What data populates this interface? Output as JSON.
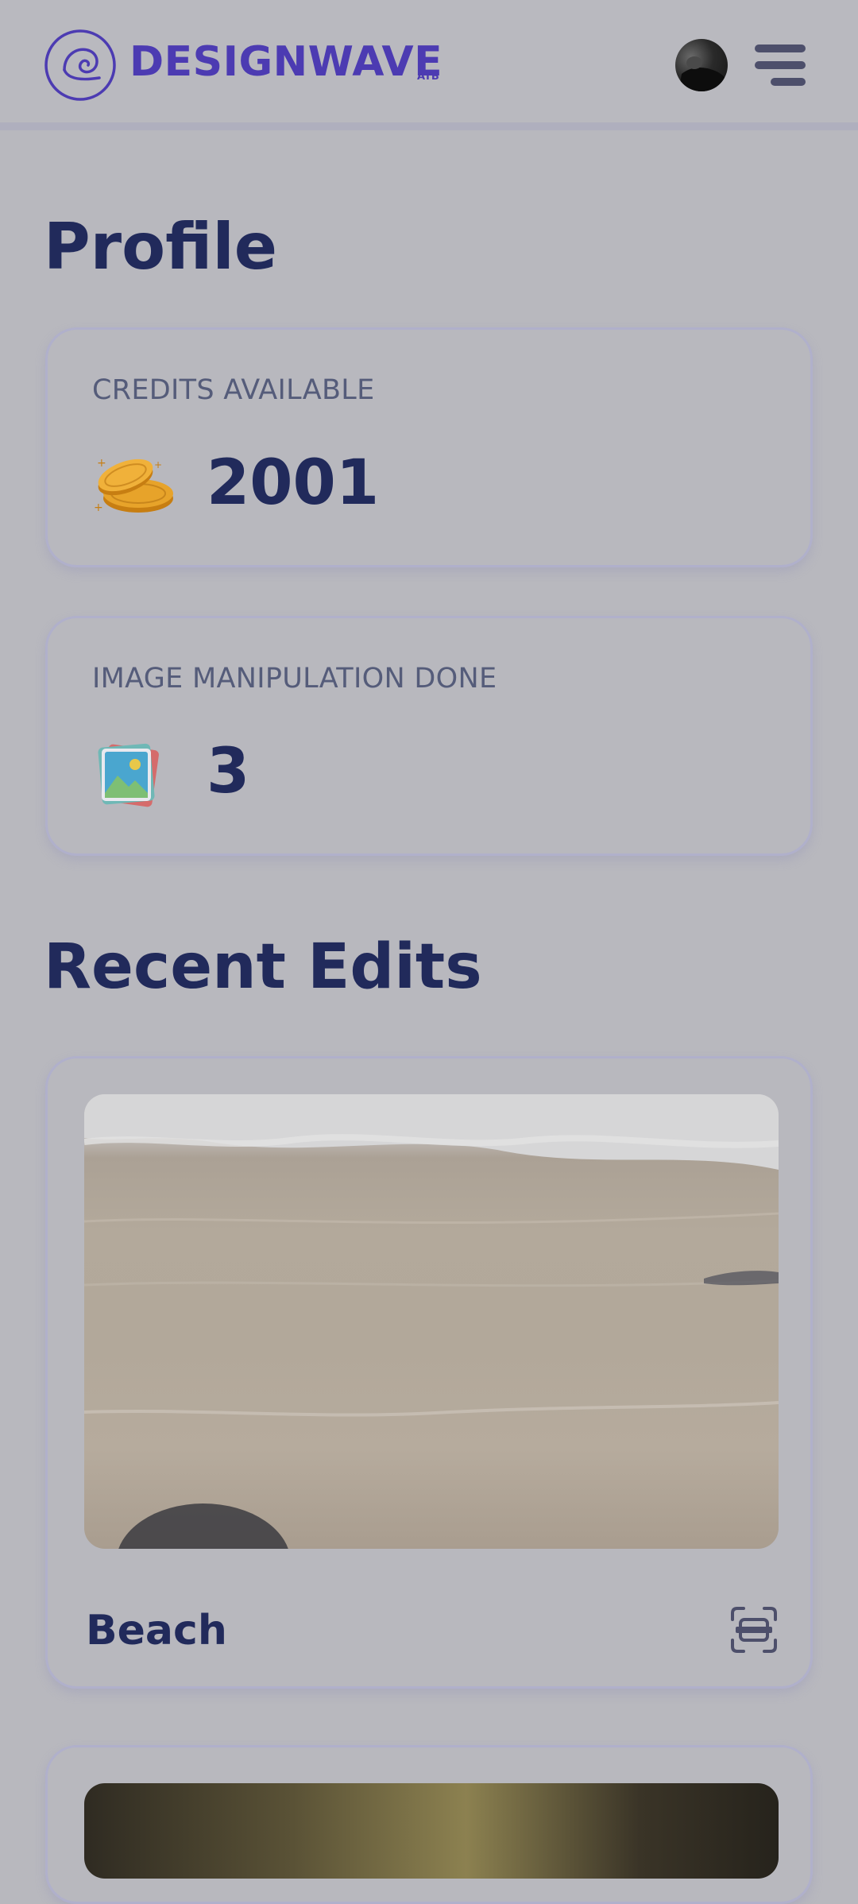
{
  "header": {
    "brand": "DESIGNWAVE",
    "brand_sub": "ATB"
  },
  "profile": {
    "title": "Profile",
    "credits_label": "CREDITS AVAILABLE",
    "credits_value": "2001",
    "manip_label": "IMAGE MANIPULATION DONE",
    "manip_value": "3"
  },
  "recent": {
    "title": "Recent Edits",
    "items": [
      {
        "name": "Beach"
      }
    ]
  },
  "colors": {
    "brand": "#4c3bb2",
    "heading": "#212a5b",
    "label": "#555c7a"
  },
  "icons": {
    "logo": "wave-logo-icon",
    "menu": "hamburger-menu-icon",
    "credits": "coins-icon",
    "manipulation": "image-stack-icon",
    "edit_action": "scan-icon"
  }
}
